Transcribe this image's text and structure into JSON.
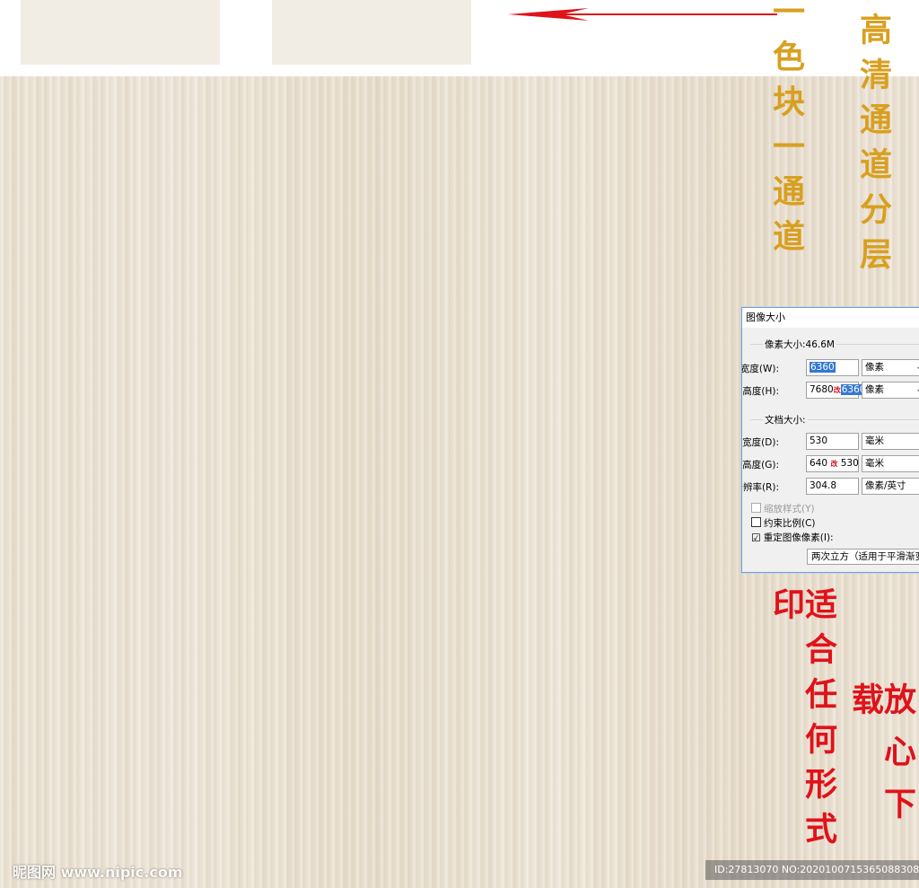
{
  "swatches": [
    "swatch-1",
    "swatch-2"
  ],
  "colors": {
    "swatch": "#f1ede5",
    "wood": "#ece3d6",
    "gold": "#d8a020",
    "red": "#e0121a",
    "arrow": "#e0121a"
  },
  "callouts": {
    "gold_left": "一色块一通道",
    "gold_right": "高清通道分层",
    "red_left": "适合任何形式印",
    "red_right": "放心下载"
  },
  "dialog": {
    "title": "图像大小",
    "pixel_dimensions_label": "像素大小:46.6M",
    "width_label": "宽度(W):",
    "width_value": "6360",
    "width_unit": "像素",
    "height_label": "高度(H):",
    "height_value_old": "7680",
    "height_mark": "改",
    "height_value_new": "6360",
    "height_unit": "像素",
    "document_size_label": "文档大小:",
    "doc_width_label": "宽度(D):",
    "doc_width_value": "530",
    "doc_width_unit": "毫米",
    "doc_height_label": "高度(G):",
    "doc_height_value_old": "640",
    "doc_height_mark": "改",
    "doc_height_value_new": "530",
    "doc_height_unit": "毫米",
    "resolution_label": "分辨率(R):",
    "resolution_value": "304.8",
    "resolution_unit": "像素/英寸",
    "scale_styles": "缩放样式(Y)",
    "constrain": "约束比例(C)",
    "resample": "重定图像像素(I):",
    "resample_method": "两次立方（适用于平滑渐变",
    "resample_checked": "☑"
  },
  "watermark": "昵图网 www.nipic.com",
  "id_text": "ID:27813070 NO:20201007153650883080"
}
